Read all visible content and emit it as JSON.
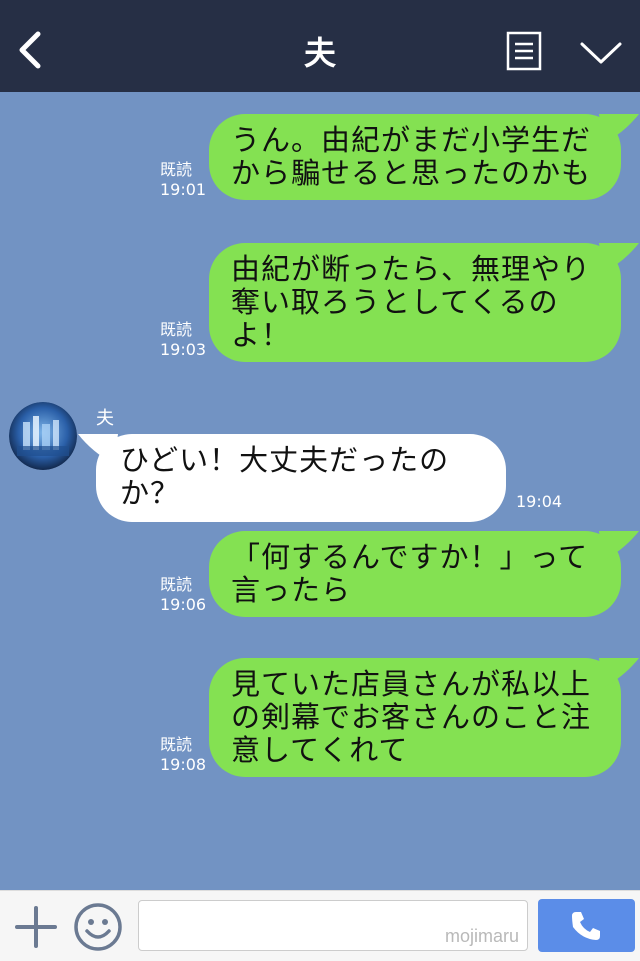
{
  "header": {
    "title": "夫"
  },
  "messages": [
    {
      "read_label": "既読",
      "time": "19:01",
      "text": "うん。由紀がまだ小学生だから騙せると思ったのかも"
    },
    {
      "read_label": "既読",
      "time": "19:03",
      "text": "由紀が断ったら、無理やり奪い取ろうとしてくるのよ！"
    },
    {
      "sender": "夫",
      "time": "19:04",
      "text": "ひどい！大丈夫だったのか？"
    },
    {
      "read_label": "既読",
      "time": "19:06",
      "text": "「何するんですか！」って言ったら"
    },
    {
      "read_label": "既読",
      "time": "19:08",
      "text": "見ていた店員さんが私以上の剣幕でお客さんのこと注意してくれて"
    }
  ],
  "footer": {
    "input_value": "",
    "watermark": "mojimaru"
  },
  "colors": {
    "header_bg": "#262f45",
    "chat_bg": "#7293c3",
    "outgoing_bubble": "#84e152",
    "incoming_bubble": "#ffffff",
    "call_button": "#5b8de8"
  },
  "icons": [
    "back-icon",
    "menu-icon",
    "chevron-down-icon",
    "plus-icon",
    "smile-icon",
    "phone-icon"
  ]
}
